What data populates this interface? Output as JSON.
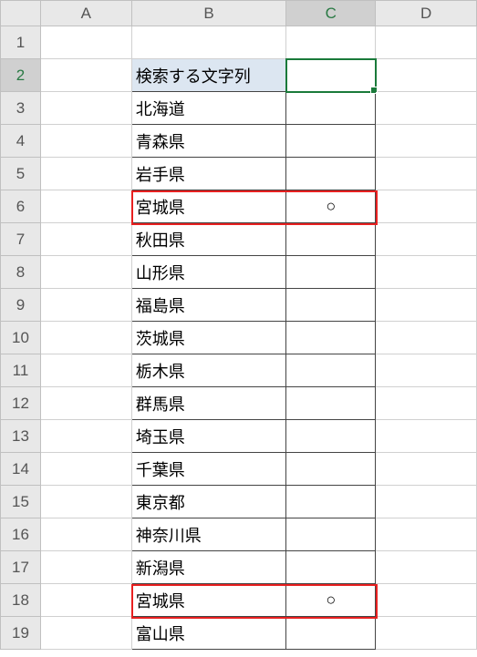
{
  "chart_data": {
    "type": "table",
    "title": "",
    "columns": [
      "",
      "A",
      "B",
      "C",
      "D"
    ],
    "rows": [
      {
        "row": 1,
        "A": "",
        "B": "",
        "C": "",
        "D": ""
      },
      {
        "row": 2,
        "A": "",
        "B": "検索する文字列",
        "C": "",
        "D": ""
      },
      {
        "row": 3,
        "A": "",
        "B": "北海道",
        "C": "",
        "D": ""
      },
      {
        "row": 4,
        "A": "",
        "B": "青森県",
        "C": "",
        "D": ""
      },
      {
        "row": 5,
        "A": "",
        "B": "岩手県",
        "C": "",
        "D": ""
      },
      {
        "row": 6,
        "A": "",
        "B": "宮城県",
        "C": "○",
        "D": ""
      },
      {
        "row": 7,
        "A": "",
        "B": "秋田県",
        "C": "",
        "D": ""
      },
      {
        "row": 8,
        "A": "",
        "B": "山形県",
        "C": "",
        "D": ""
      },
      {
        "row": 9,
        "A": "",
        "B": "福島県",
        "C": "",
        "D": ""
      },
      {
        "row": 10,
        "A": "",
        "B": "茨城県",
        "C": "",
        "D": ""
      },
      {
        "row": 11,
        "A": "",
        "B": "栃木県",
        "C": "",
        "D": ""
      },
      {
        "row": 12,
        "A": "",
        "B": "群馬県",
        "C": "",
        "D": ""
      },
      {
        "row": 13,
        "A": "",
        "B": "埼玉県",
        "C": "",
        "D": ""
      },
      {
        "row": 14,
        "A": "",
        "B": "千葉県",
        "C": "",
        "D": ""
      },
      {
        "row": 15,
        "A": "",
        "B": "東京都",
        "C": "",
        "D": ""
      },
      {
        "row": 16,
        "A": "",
        "B": "神奈川県",
        "C": "",
        "D": ""
      },
      {
        "row": 17,
        "A": "",
        "B": "新潟県",
        "C": "",
        "D": ""
      },
      {
        "row": 18,
        "A": "",
        "B": "宮城県",
        "C": "○",
        "D": ""
      },
      {
        "row": 19,
        "A": "",
        "B": "富山県",
        "C": "",
        "D": ""
      }
    ],
    "highlighted_rows": [
      6,
      18
    ],
    "active_cell": "C2"
  },
  "headers": {
    "cols": [
      "A",
      "B",
      "C",
      "D"
    ],
    "rows": [
      "1",
      "2",
      "3",
      "4",
      "5",
      "6",
      "7",
      "8",
      "9",
      "10",
      "11",
      "12",
      "13",
      "14",
      "15",
      "16",
      "17",
      "18",
      "19"
    ]
  },
  "cells": {
    "B2": "検索する文字列",
    "B3": "北海道",
    "B4": "青森県",
    "B5": "岩手県",
    "B6": "宮城県",
    "B7": "秋田県",
    "B8": "山形県",
    "B9": "福島県",
    "B10": "茨城県",
    "B11": "栃木県",
    "B12": "群馬県",
    "B13": "埼玉県",
    "B14": "千葉県",
    "B15": "東京都",
    "B16": "神奈川県",
    "B17": "新潟県",
    "B18": "宮城県",
    "B19": "富山県",
    "C6": "○",
    "C18": "○"
  }
}
